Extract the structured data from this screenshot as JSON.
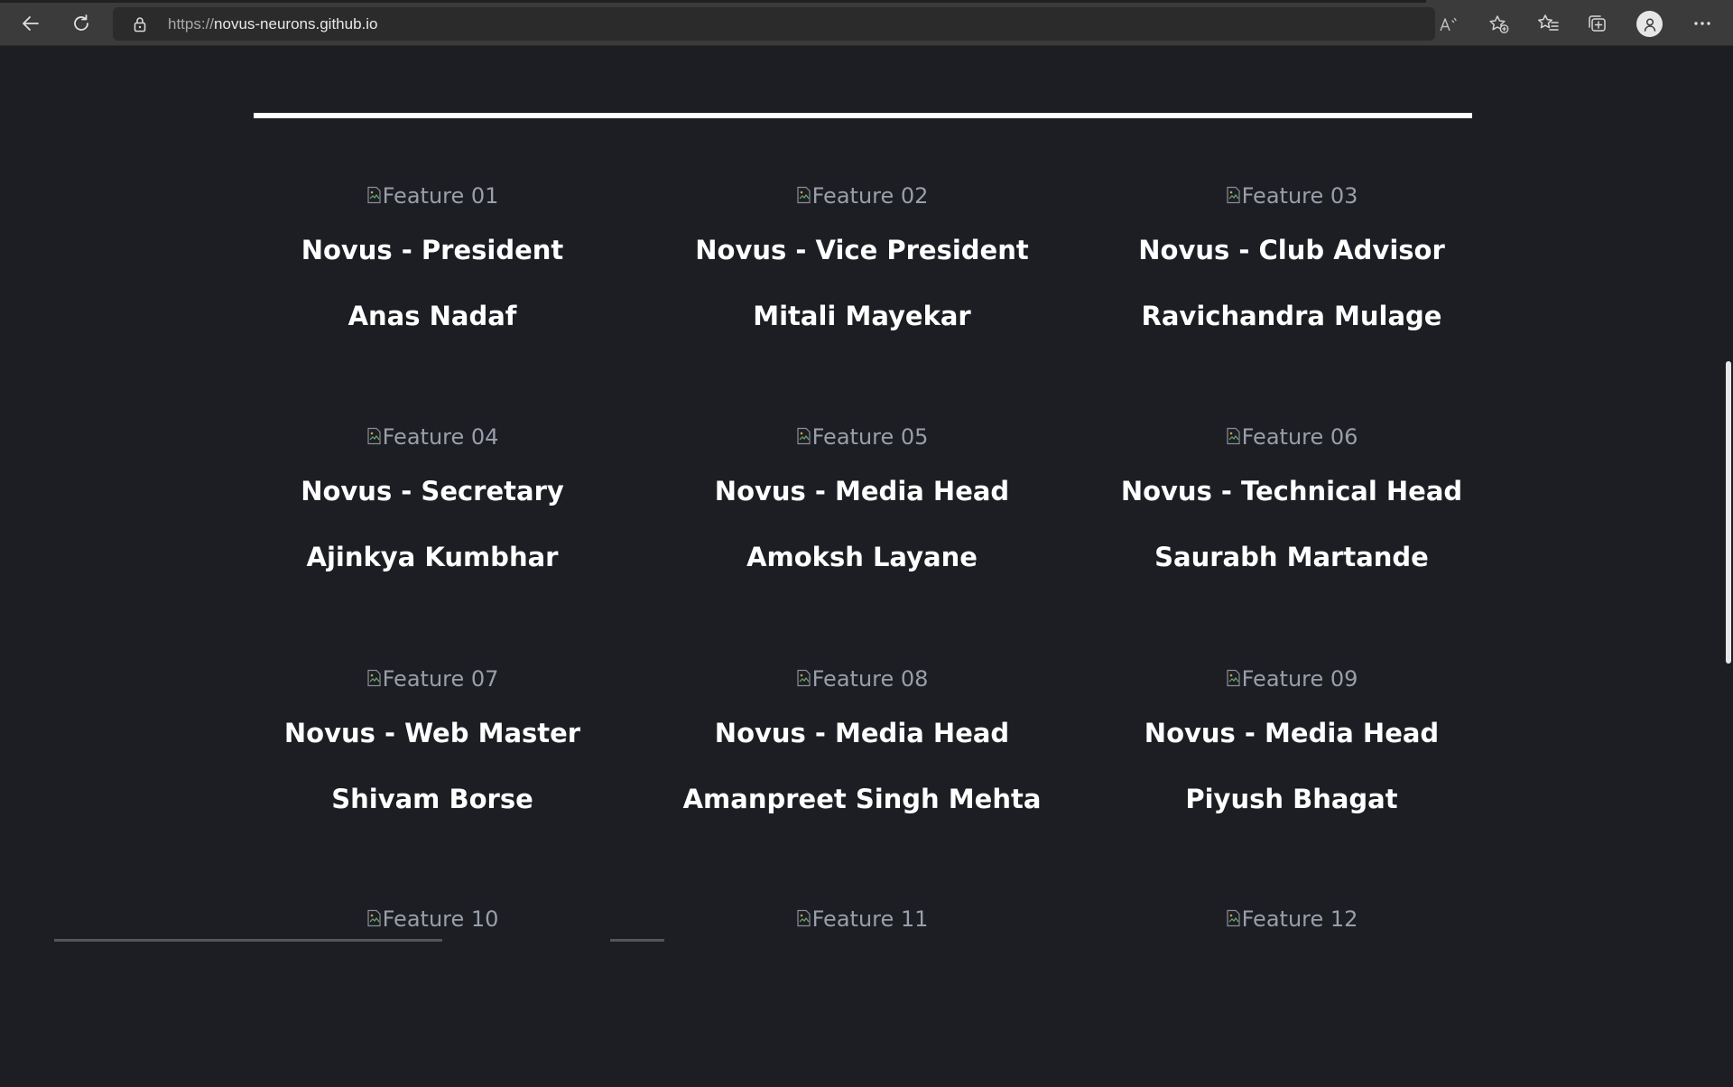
{
  "browser": {
    "url_protocol": "https://",
    "url_host": "novus-neurons.github.io",
    "icons": [
      "back-icon",
      "refresh-icon",
      "lock-icon",
      "read-aloud-icon",
      "add-favorite-icon",
      "favorites-icon",
      "collections-icon",
      "profile-icon",
      "more-icon"
    ]
  },
  "team": [
    {
      "img_alt": "Feature 01",
      "role": "Novus - President",
      "name": "Anas Nadaf"
    },
    {
      "img_alt": "Feature 02",
      "role": "Novus - Vice President",
      "name": "Mitali Mayekar"
    },
    {
      "img_alt": "Feature 03",
      "role": "Novus - Club Advisor",
      "name": "Ravichandra Mulage"
    },
    {
      "img_alt": "Feature 04",
      "role": "Novus - Secretary",
      "name": "Ajinkya Kumbhar"
    },
    {
      "img_alt": "Feature 05",
      "role": "Novus - Media Head",
      "name": "Amoksh Layane"
    },
    {
      "img_alt": "Feature 06",
      "role": "Novus - Technical Head",
      "name": "Saurabh Martande"
    },
    {
      "img_alt": "Feature 07",
      "role": "Novus - Web Master",
      "name": "Shivam Borse"
    },
    {
      "img_alt": "Feature 08",
      "role": "Novus - Media Head",
      "name": "Amanpreet Singh Mehta"
    },
    {
      "img_alt": "Feature 09",
      "role": "Novus - Media Head",
      "name": "Piyush Bhagat"
    },
    {
      "img_alt": "Feature 10",
      "role": "",
      "name": ""
    },
    {
      "img_alt": "Feature 11",
      "role": "",
      "name": ""
    },
    {
      "img_alt": "Feature 12",
      "role": "",
      "name": ""
    }
  ]
}
